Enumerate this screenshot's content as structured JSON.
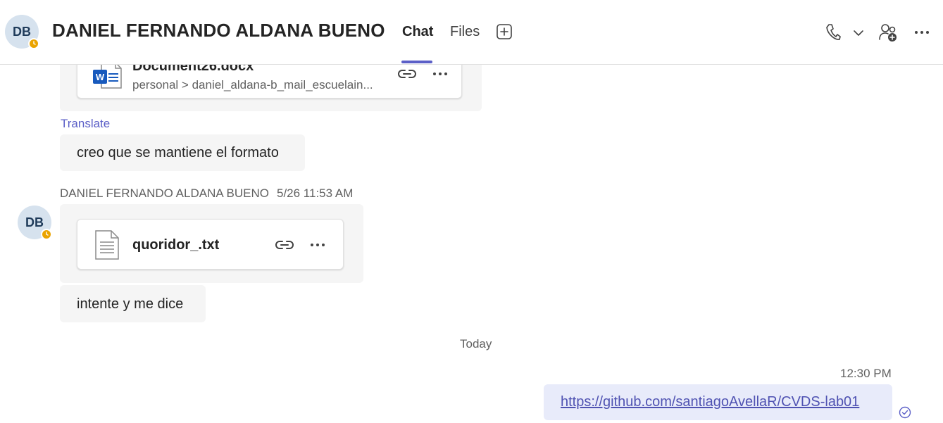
{
  "header": {
    "avatar_initials": "DB",
    "title": "DANIEL FERNANDO ALDANA BUENO",
    "tabs": [
      {
        "label": "Chat",
        "active": true
      },
      {
        "label": "Files",
        "active": false
      }
    ],
    "icons": [
      "add-tab-icon",
      "phone-icon",
      "chevron-down-icon",
      "add-people-icon",
      "more-icon"
    ]
  },
  "messages": {
    "doc_card": {
      "file_name": "Document26.docx",
      "path": "personal > daniel_aldana-b_mail_escuelain..."
    },
    "translate_label": "Translate",
    "text1": "creo que se mantiene el formato",
    "sender_block": {
      "avatar_initials": "DB",
      "sender": "DANIEL FERNANDO ALDANA BUENO",
      "time": "5/26 11:53 AM"
    },
    "txt_card": {
      "file_name": "quoridor_.txt"
    },
    "text2": "intente y me dice",
    "date_divider": "Today",
    "my_time": "12:30 PM",
    "my_link": "https://github.com/santiagoAvellaR/CVDS-lab01"
  },
  "colors": {
    "accent": "#5b5fc7",
    "presence_away": "#eaa300",
    "bubble_other": "#f5f5f5",
    "bubble_mine": "#e8ebfa",
    "word_blue": "#185abd"
  }
}
